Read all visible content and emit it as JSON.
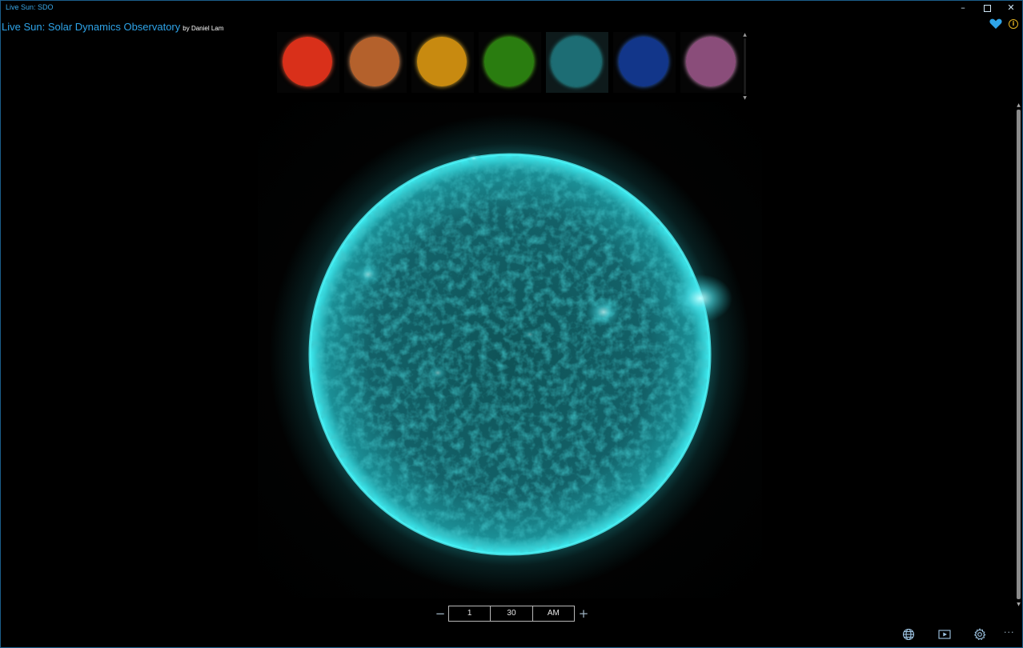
{
  "window": {
    "title": "Live Sun: SDO",
    "minimize_glyph": "–",
    "close_glyph": "✕"
  },
  "header": {
    "title": "Live Sun: Solar Dynamics Observatory",
    "author": "by Daniel Lam",
    "favorite_icon": "heart-icon",
    "info_icon": "info-icon",
    "info_glyph": "i"
  },
  "thumbnails": [
    {
      "name": "red",
      "color": "#d9301a",
      "edge": "#ff5533"
    },
    {
      "name": "copper",
      "color": "#b4612c",
      "edge": "#e89c66"
    },
    {
      "name": "gold",
      "color": "#c88a10",
      "edge": "#f5bb2a"
    },
    {
      "name": "green",
      "color": "#2a7d10",
      "edge": "#59d21e"
    },
    {
      "name": "teal",
      "color": "#1d6d74",
      "edge": "#34d2da"
    },
    {
      "name": "blue",
      "color": "#12368a",
      "edge": "#2e6de0"
    },
    {
      "name": "pink",
      "color": "#8a4d7a",
      "edge": "#e39bcf"
    }
  ],
  "selected_thumbnail": 4,
  "strip_scroll": {
    "up": "▲",
    "down": "▼"
  },
  "main_scroll": {
    "up": "▲",
    "down": "▼"
  },
  "time": {
    "decrement": "−",
    "hour": "1",
    "minute": "30",
    "period": "AM",
    "increment": "+"
  },
  "commands": {
    "globe_icon": "globe-icon",
    "video_icon": "video-icon",
    "settings_icon": "gear-icon",
    "more_glyph": "···"
  },
  "colors": {
    "accent": "#2ea4e9",
    "sun": "#23b8bf",
    "info": "#e6b422"
  }
}
